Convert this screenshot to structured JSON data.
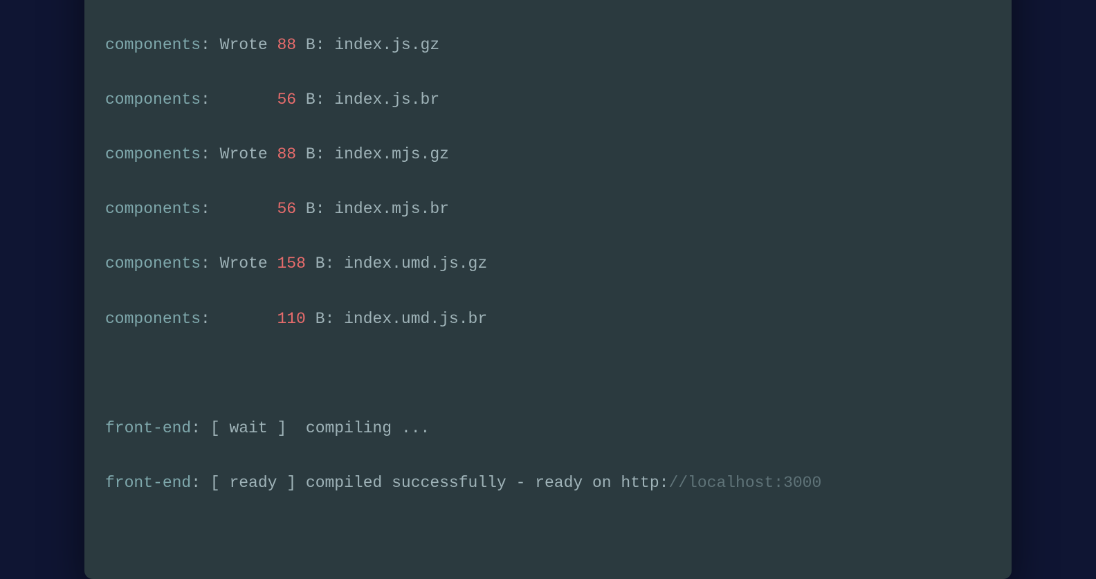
{
  "terminal": {
    "lines": [
      {
        "prefix": "components",
        "wrote": "Wrote",
        "size": "88",
        "unit": "B",
        "file": "index.js.gz"
      },
      {
        "prefix": "components",
        "wrote": "",
        "size": "56",
        "unit": "B",
        "file": "index.js.br"
      },
      {
        "prefix": "components",
        "wrote": "Wrote",
        "size": "88",
        "unit": "B",
        "file": "index.mjs.gz"
      },
      {
        "prefix": "components",
        "wrote": "",
        "size": "56",
        "unit": "B",
        "file": "index.mjs.br"
      },
      {
        "prefix": "components",
        "wrote": "Wrote",
        "size": "158",
        "unit": "B",
        "file": "index.umd.js.gz"
      },
      {
        "prefix": "components",
        "wrote": "",
        "size": "110",
        "unit": "B",
        "file": "index.umd.js.br"
      }
    ],
    "frontend": {
      "wait": {
        "prefix": "front-end",
        "status": "wait",
        "message": "compiling",
        "dots": "..."
      },
      "ready": {
        "prefix": "front-end",
        "status": "ready",
        "message": "compiled successfully",
        "sep": "-",
        "ready_on": "ready on",
        "proto": "http:",
        "url_rest": "//localhost:3000"
      }
    }
  }
}
